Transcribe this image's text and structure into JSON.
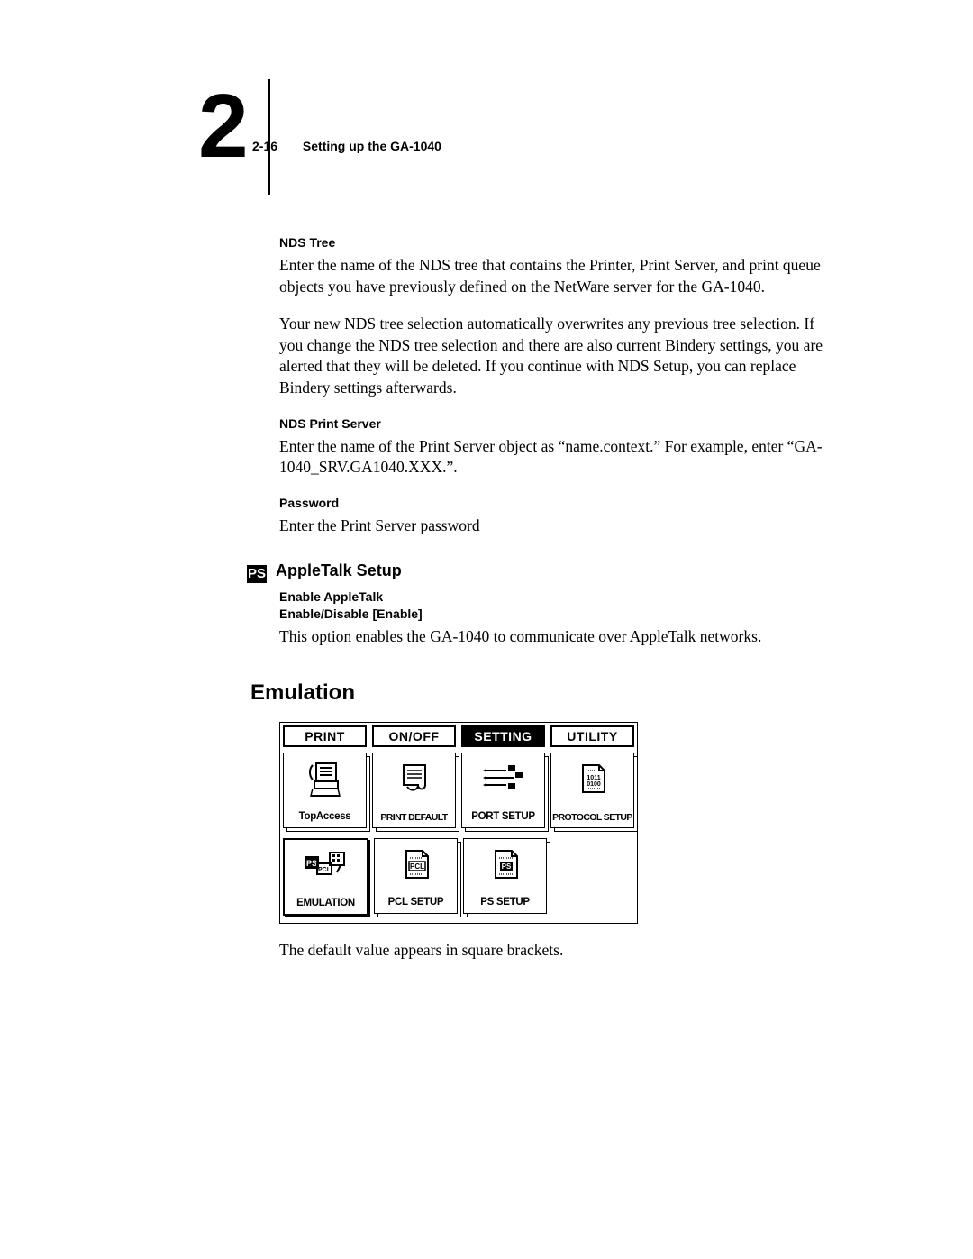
{
  "header": {
    "chapter_symbol": "2",
    "page_num": "2-16",
    "page_label": "Setting up the GA-1040"
  },
  "ndstree": {
    "heading": "NDS Tree",
    "p1": "Enter the name of the NDS tree that contains the Printer, Print Server, and print queue objects you have previously defined on the NetWare server for the GA-1040.",
    "p2": "Your new NDS tree selection automatically overwrites any previous tree selection. If you change the NDS tree selection and there are also current Bindery settings, you are alerted that they will be deleted. If you continue with NDS Setup, you can replace Bindery settings afterwards."
  },
  "ndsps": {
    "heading": "NDS Print Server",
    "p": "Enter the name of the Print Server object as “name.context.” For example, enter “GA-1040_SRV.GA1040.XXX.”."
  },
  "pw": {
    "heading": "Password",
    "p": "Enter the Print Server password"
  },
  "appletalk": {
    "badge": "PS",
    "heading": "AppleTalk Setup",
    "sub1": "Enable AppleTalk",
    "sub2": "Enable/Disable [Enable]",
    "p": "This option enables the GA-1040 to communicate over AppleTalk networks."
  },
  "emulation": {
    "heading": "Emulation",
    "note": "The default value appears in square brackets."
  },
  "panel": {
    "tabs": [
      "PRINT",
      "ON/OFF",
      "SETTING",
      "UTILITY"
    ],
    "selected_tab": "SETTING",
    "row1": [
      "TopAccess",
      "PRINT DEFAULT",
      "PORT SETUP",
      "PROTOCOL SETUP"
    ],
    "row2": [
      "EMULATION",
      "PCL SETUP",
      "PS SETUP",
      ""
    ],
    "selected_cell": "EMULATION",
    "proto_bits": "1011\n0100"
  }
}
